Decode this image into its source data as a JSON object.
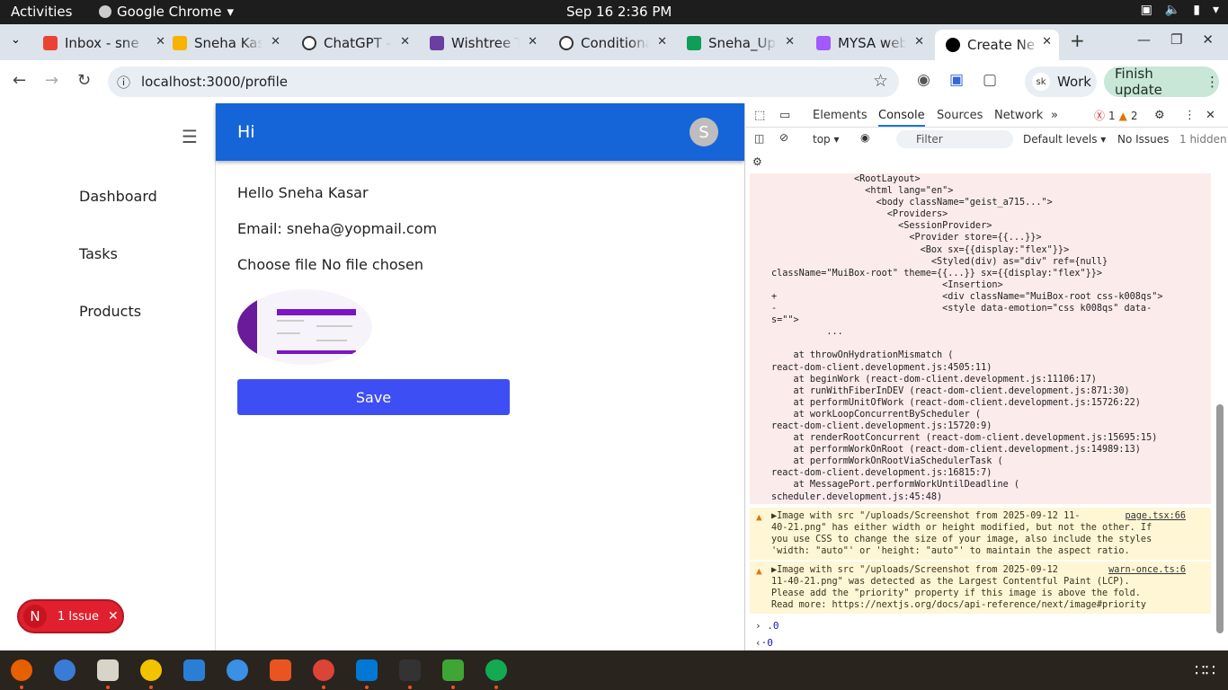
{
  "system": {
    "activities": "Activities",
    "app": "Google Chrome",
    "clock": "Sep 16  2:36 PM"
  },
  "tabs": [
    {
      "label": "Inbox - sne",
      "color": "#ea4335"
    },
    {
      "label": "Sneha Kas",
      "color": "#f6b400"
    },
    {
      "label": "ChatGPT -",
      "color": "#333333"
    },
    {
      "label": "Wishtree T",
      "color": "#6b3fa0"
    },
    {
      "label": "Conditiona",
      "color": "#333333"
    },
    {
      "label": "Sneha_Ups",
      "color": "#0f9d58"
    },
    {
      "label": "MYSA web",
      "color": "#a259ff"
    },
    {
      "label": "Create Ne",
      "color": "#000000"
    }
  ],
  "toolbar": {
    "url": "localhost:3000/profile",
    "profile": "Work",
    "profile_initials": "sk",
    "finish_update": "Finish update"
  },
  "app": {
    "title": "Hi",
    "avatar": "S",
    "nav": [
      "Dashboard",
      "Tasks",
      "Products"
    ],
    "greeting": "Hello Sneha Kasar",
    "email": "Email: sneha@yopmail.com",
    "file": "Choose file No file chosen",
    "save": "Save",
    "issue_badge": "N",
    "issue": "1 Issue"
  },
  "devtools": {
    "tabs": [
      "Elements",
      "Console",
      "Sources",
      "Network"
    ],
    "errors": "1",
    "warnings": "2",
    "context": "top",
    "filter": "Filter",
    "levels": "Default levels",
    "issues": "No Issues",
    "hidden": "1 hidden",
    "trace": "               <RootLayout>\n                 <html lang=\"en\">\n                   <body className=\"geist_a715...\">\n                     <Providers>\n                       <SessionProvider>\n                         <Provider store={{...}}>\n                           <Box sx={{display:\"flex\"}}>\n                             <Styled(div) as=\"div\" ref={null}\nclassName=\"MuiBox-root\" theme={{...}} sx={{display:\"flex\"}}>\n                               <Insertion>\n+                              <div className=\"MuiBox-root css-k008qs\">\n-                              <style data-emotion=\"css k008qs\" data-\ns=\"\">\n          ...\n\n    at throwOnHydrationMismatch (\nreact-dom-client.development.js:4505:11)\n    at beginWork (react-dom-client.development.js:11106:17)\n    at runWithFiberInDEV (react-dom-client.development.js:871:30)\n    at performUnitOfWork (react-dom-client.development.js:15726:22)\n    at workLoopConcurrentByScheduler (\nreact-dom-client.development.js:15720:9)\n    at renderRootConcurrent (react-dom-client.development.js:15695:15)\n    at performWorkOnRoot (react-dom-client.development.js:14989:13)\n    at performWorkOnRootViaSchedulerTask (\nreact-dom-client.development.js:16815:7)\n    at MessagePort.performWorkUntilDeadline (\nscheduler.development.js:45:48)",
    "warn1": "▶Image with src \"/uploads/Screenshot from 2025-09-12 11-\n40-21.png\" has either width or height modified, but not the other. If\nyou use CSS to change the size of your image, also include the styles\n'width: \"auto\"' or 'height: \"auto\"' to maintain the aspect ratio.",
    "warn1_src": "page.tsx:66",
    "warn2": "▶Image with src \"/uploads/Screenshot from 2025-09-12\n11-40-21.png\" was detected as the Largest Contentful Paint (LCP).\nPlease add the \"priority\" property if this image is above the fold.\nRead more: https://nextjs.org/docs/api-reference/next/image#priority",
    "warn2_src": "warn-once.ts:6",
    "input1": ".0",
    "output1": "0"
  }
}
